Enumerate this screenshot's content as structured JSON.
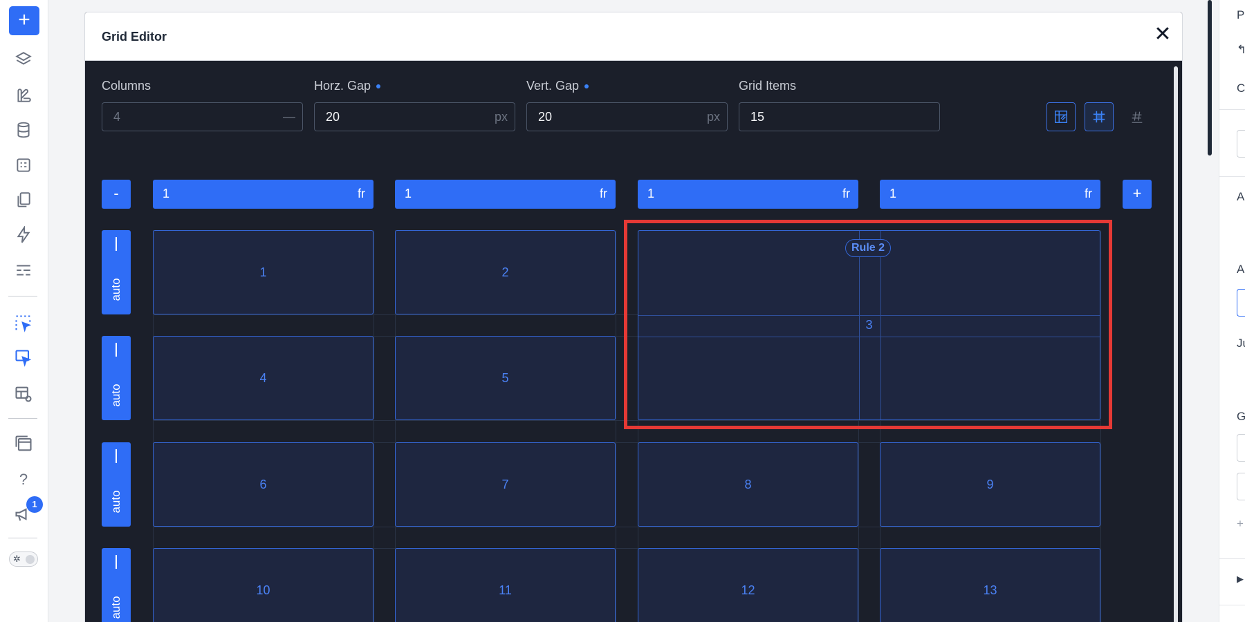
{
  "leftbar": {
    "add_label": "+",
    "icons": [
      "layers-icon",
      "palette-icon",
      "database-icon",
      "form-icon",
      "pages-icon",
      "lightning-icon",
      "list-icon",
      "select-element-icon",
      "select-element-alt-icon",
      "table-view-icon",
      "window-stack-icon",
      "help-icon",
      "announcement-icon"
    ],
    "help_label": "?",
    "notification_count": "1"
  },
  "modal": {
    "title": "Grid Editor",
    "close_label": "✕"
  },
  "fields": {
    "columns": {
      "label": "Columns",
      "value": "4",
      "suffix": "—"
    },
    "horz_gap": {
      "label": "Horz. Gap",
      "value": "20",
      "suffix": "px"
    },
    "vert_gap": {
      "label": "Vert. Gap",
      "value": "20",
      "suffix": "px"
    },
    "grid_items": {
      "label": "Grid Items",
      "value": "15"
    }
  },
  "column_controls": {
    "remove_label": "-",
    "add_label": "+",
    "tracks": [
      {
        "value": "1",
        "unit": "fr"
      },
      {
        "value": "1",
        "unit": "fr"
      },
      {
        "value": "1",
        "unit": "fr"
      },
      {
        "value": "1",
        "unit": "fr"
      }
    ]
  },
  "row_controls": [
    {
      "label": "auto"
    },
    {
      "label": "auto"
    },
    {
      "label": "auto"
    },
    {
      "label": "auto"
    }
  ],
  "cells": [
    "1",
    "2",
    "3",
    "4",
    "5",
    "6",
    "7",
    "8",
    "9",
    "10",
    "11",
    "12",
    "13"
  ],
  "rule_badge": "Rule 2",
  "rightpanel": {
    "fragments": [
      "Pa",
      "↰",
      "C",
      "A",
      "A",
      "Ju",
      "G",
      "+",
      "▶"
    ]
  },
  "colors": {
    "accent": "#2f6df6",
    "modal_bg": "#1b1f2a",
    "cell_bg": "#1e2640",
    "cell_text": "#4b82f5",
    "highlight": "#e53935"
  }
}
